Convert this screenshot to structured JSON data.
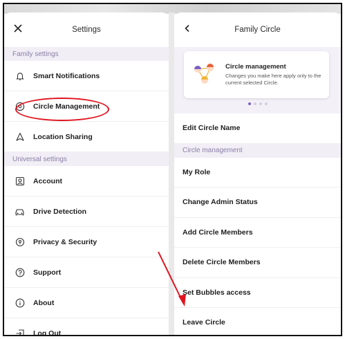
{
  "left": {
    "title": "Settings",
    "close_icon": "close-icon",
    "sections": [
      {
        "header": "Family settings",
        "items": [
          {
            "label": "Smart Notifications",
            "icon": "bell-icon"
          },
          {
            "label": "Circle Management",
            "icon": "circle-target-icon"
          },
          {
            "label": "Location Sharing",
            "icon": "location-arrow-icon"
          }
        ]
      },
      {
        "header": "Universal settings",
        "items": [
          {
            "label": "Account",
            "icon": "account-icon"
          },
          {
            "label": "Drive Detection",
            "icon": "car-icon"
          },
          {
            "label": "Privacy & Security",
            "icon": "privacy-icon"
          },
          {
            "label": "Support",
            "icon": "help-icon"
          },
          {
            "label": "About",
            "icon": "info-icon"
          },
          {
            "label": "Log Out",
            "icon": "logout-icon"
          }
        ]
      }
    ]
  },
  "right": {
    "title": "Family Circle",
    "back_icon": "back-chevron-icon",
    "card": {
      "title": "Circle management",
      "description": "Changes you make here apply only to the current selected Circle.",
      "page_count": 4,
      "active_page": 1
    },
    "top_item": "Edit Circle Name",
    "section_header": "Circle management",
    "items": [
      "My Role",
      "Change Admin Status",
      "Add Circle Members",
      "Delete Circle Members",
      "Set Bubbles access",
      "Leave Circle"
    ]
  },
  "colors": {
    "annotation": "#e0141f",
    "accent": "#7b5fc7",
    "section_bg": "#f1eef6",
    "section_text": "#8a7fa6"
  }
}
